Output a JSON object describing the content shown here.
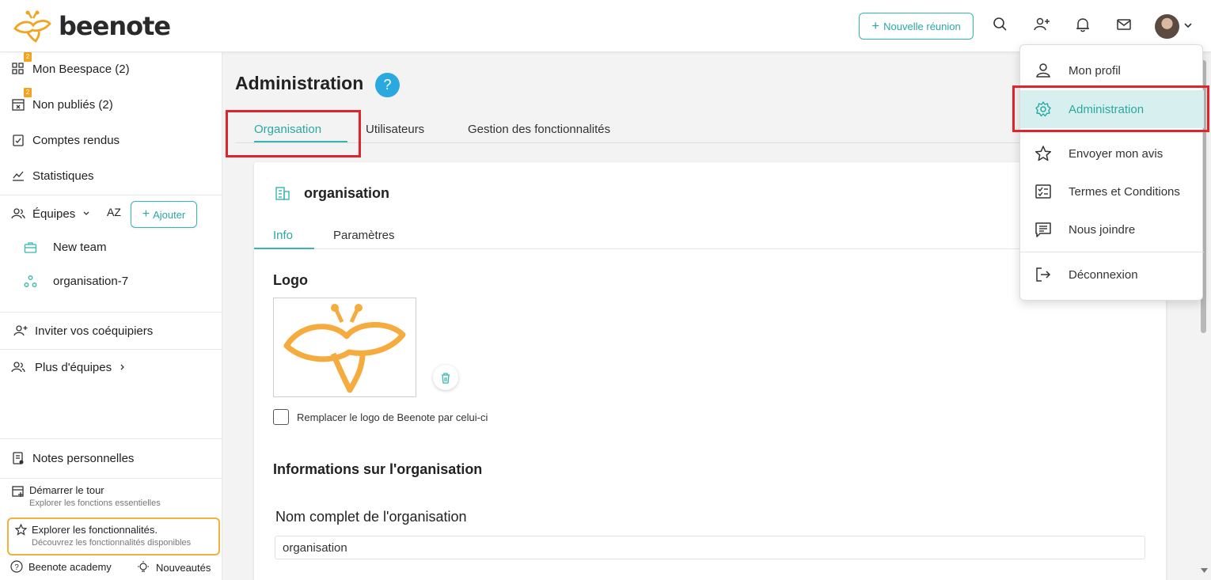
{
  "header": {
    "logo_text": "beenote",
    "new_meeting_label": "Nouvelle réunion",
    "icons": [
      "search-icon",
      "add-user-icon",
      "bell-icon",
      "mail-icon"
    ]
  },
  "sidebar": {
    "mon_beespace": {
      "label": "Mon Beespace (2)",
      "badge": "2"
    },
    "non_publies": {
      "label": "Non publiés (2)",
      "badge": "2"
    },
    "comptes_rendus": "Comptes rendus",
    "statistiques": "Statistiques",
    "equipes_label": "Équipes",
    "sort_label": "AZ",
    "add_label": "Ajouter",
    "teams": [
      "New team",
      "organisation-7"
    ],
    "invite_label": "Inviter vos coéquipiers",
    "more_teams_label": "Plus d'équipes",
    "notes_label": "Notes personnelles",
    "tour_title": "Démarrer le tour",
    "tour_sub": "Explorer les fonctions essentielles",
    "explore_title": "Explorer les fonctionnalités.",
    "explore_sub": "Découvrez les fonctionnalités disponibles",
    "academy_label": "Beenote academy",
    "news_label": "Nouveautés"
  },
  "main": {
    "page_title": "Administration",
    "help_symbol": "?",
    "tabs": [
      "Organisation",
      "Utilisateurs",
      "Gestion des fonctionnalités"
    ],
    "card": {
      "title": "organisation",
      "inner_tabs": [
        "Info",
        "Paramètres"
      ],
      "logo_section_title": "Logo",
      "replace_logo_label": "Remplacer le logo de Beenote par celui-ci",
      "org_info_title": "Informations sur l'organisation",
      "full_name_label": "Nom complet de l'organisation",
      "full_name_value": "organisation"
    }
  },
  "user_menu": {
    "items": [
      "Mon profil",
      "Administration",
      "Envoyer mon avis",
      "Termes et Conditions",
      "Nous joindre",
      "Déconnexion"
    ],
    "active": "Administration"
  },
  "colors": {
    "accent": "#35b6b0",
    "highlight": "#e0242b",
    "brand": "#f2a41f",
    "help": "#29a9e0"
  }
}
